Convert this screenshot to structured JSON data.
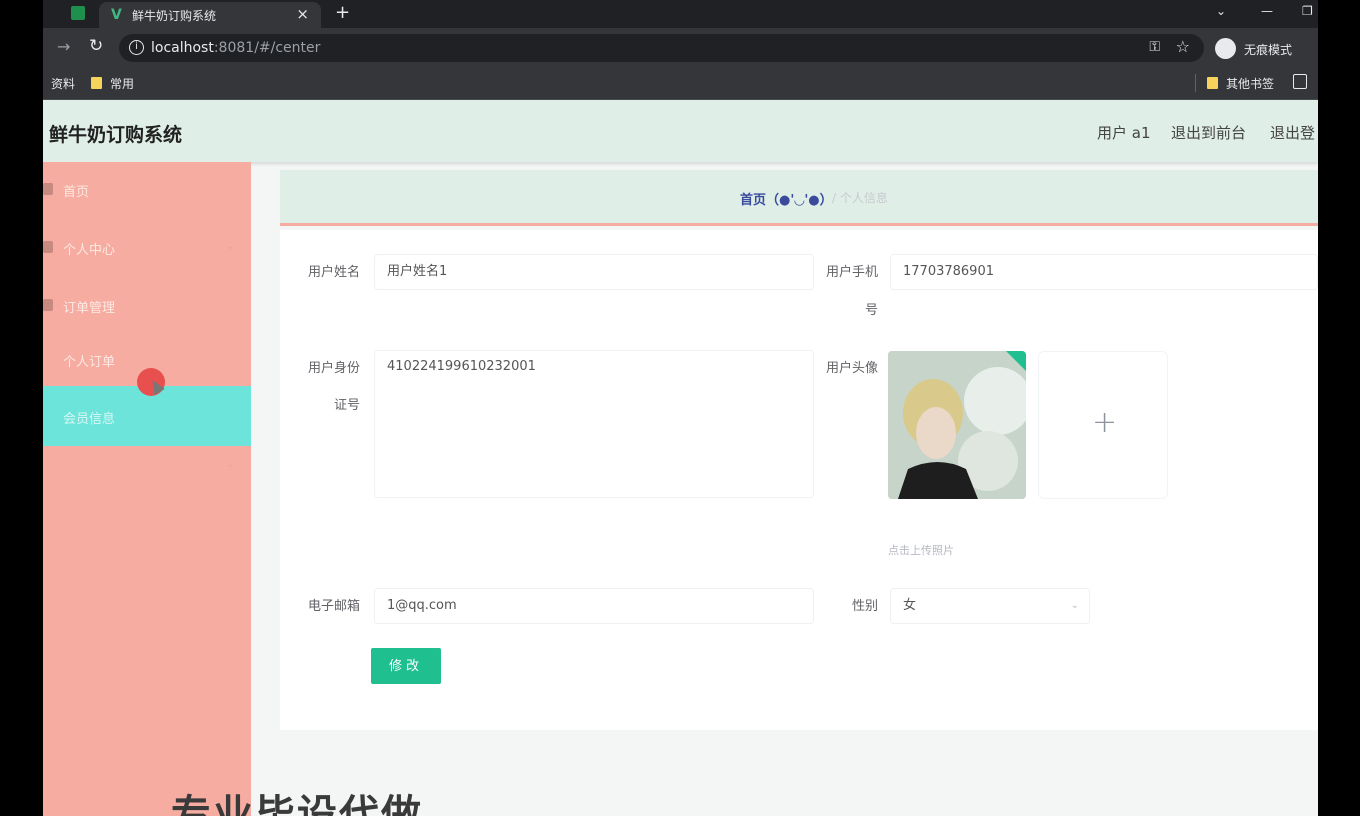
{
  "browser": {
    "tab_title": "鲜牛奶订购系统",
    "url_host": "localhost",
    "url_rest": ":8081/#/center",
    "incognito_label": "无痕模式",
    "bookmarks": [
      "资料",
      "常用"
    ],
    "other_bookmarks": "其他书签"
  },
  "header": {
    "app_title": "鲜牛奶订购系统",
    "user_label": "用户 a1",
    "to_front": "退出到前台",
    "logout": "退出登"
  },
  "sidebar": {
    "items": [
      {
        "label": "首页"
      },
      {
        "label": "个人中心"
      },
      {
        "label": "订单管理"
      },
      {
        "label": "个人订单"
      },
      {
        "label": "会员信息"
      },
      {
        "label": ""
      }
    ]
  },
  "breadcrumb": {
    "home": "首页（●'◡'●）",
    "current": "个人信息"
  },
  "form": {
    "username_label": "用户姓名",
    "username_value": "用户姓名1",
    "phone_label_1": "用户手机",
    "phone_label_2": "号",
    "phone_value": "17703786901",
    "idcard_label_1": "用户身份",
    "idcard_label_2": "证号",
    "idcard_value": "410224199610232001",
    "avatar_label": "用户头像",
    "upload_tip": "点击上传照片",
    "email_label": "电子邮箱",
    "email_value": "1@qq.com",
    "gender_label": "性别",
    "gender_value": "女",
    "submit_label": "修改"
  },
  "overlay_text": "专业毕设代做"
}
